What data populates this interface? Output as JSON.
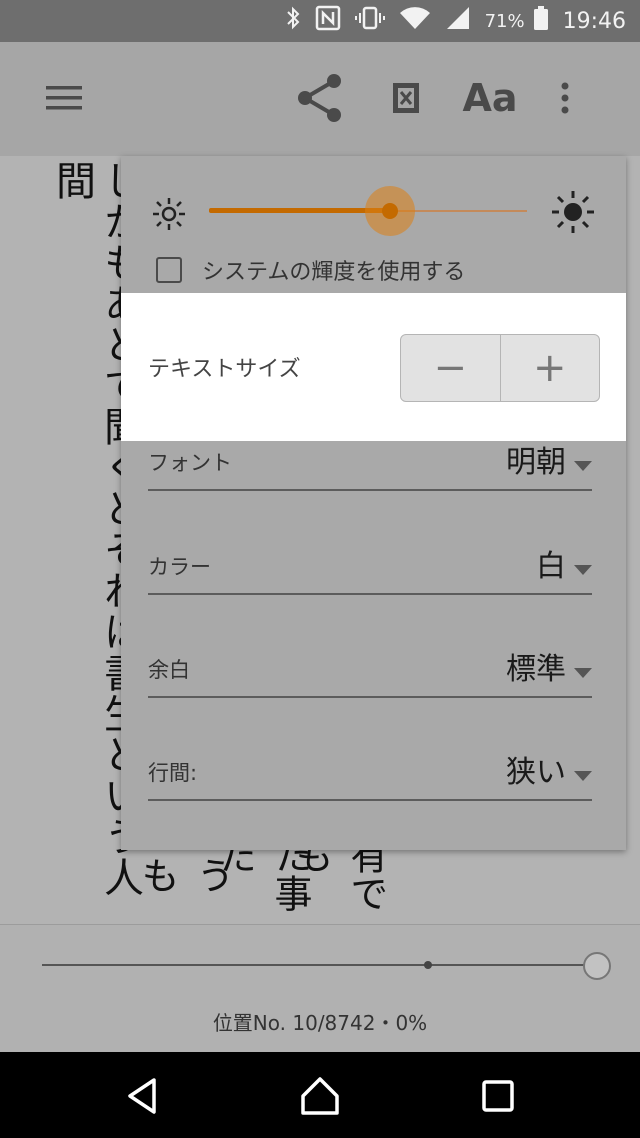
{
  "status_bar": {
    "battery_percent": "71%",
    "time": "19:46",
    "icons": [
      "bluetooth-icon",
      "nfc-icon",
      "vibrate-icon",
      "wifi-icon",
      "signal-icon",
      "battery-icon"
    ]
  },
  "toolbar": {
    "icons": [
      "menu-icon",
      "share-icon",
      "xray-icon",
      "more-icon"
    ],
    "font_button_label": "Aa"
  },
  "book": {
    "columns": [
      "しかもあとで聞くとそれは書生という人間",
      "うも",
      "た事だ",
      "有でも"
    ]
  },
  "settings": {
    "brightness": {
      "level": 0.57
    },
    "use_system_brightness": {
      "label": "システムの輝度を使用する",
      "checked": false
    },
    "text_size": {
      "label": "テキストサイズ",
      "decrease": "−",
      "increase": "+"
    },
    "font": {
      "label": "フォント",
      "value": "明朝"
    },
    "color": {
      "label": "カラー",
      "value": "白"
    },
    "margin": {
      "label": "余白",
      "value": "標準"
    },
    "line_spacing": {
      "label": "行間:",
      "value": "狭い"
    }
  },
  "progress": {
    "location_text": "位置No. 10/8742・0%",
    "position_fraction": 1.0
  },
  "colors": {
    "accent": "#c46a00",
    "accent_halo": "#dd8014"
  }
}
